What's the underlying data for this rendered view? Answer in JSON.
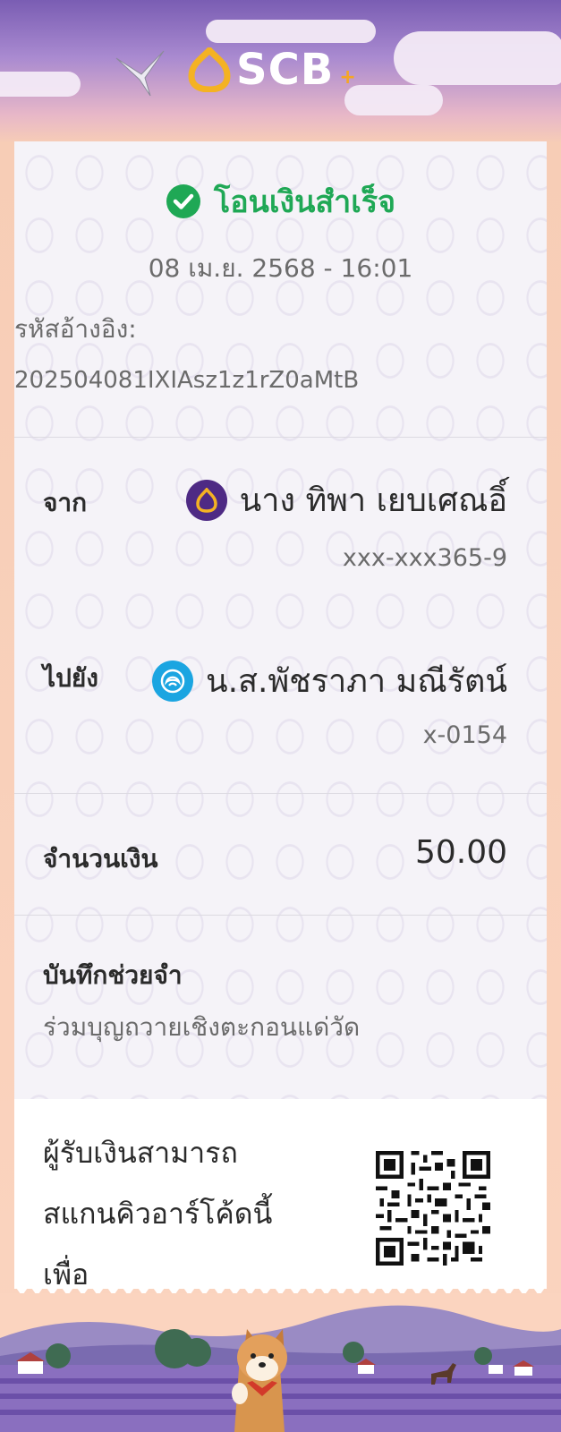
{
  "header": {
    "logo_text": "SCB",
    "logo_plus": "+"
  },
  "status": {
    "text": "โอนเงินสำเร็จ"
  },
  "datetime": "08 เม.ย. 2568 - 16:01",
  "reference": {
    "label": "รหัสอ้างอิง:",
    "value": "202504081IXIAsz1z1rZ0aMtB"
  },
  "from": {
    "label": "จาก",
    "name": "นาง ทิพา เยบเศณอิ์",
    "account": "xxx-xxx365-9",
    "bank_icon": "scb-icon",
    "bank_color": "#4e2a84"
  },
  "to": {
    "label": "ไปยัง",
    "name": "น.ส.พัชราภา มณีรัตน์",
    "account": "x-0154",
    "bank_icon": "krungthai-icon",
    "bank_color": "#1ba5e1"
  },
  "amount": {
    "label": "จำนวนเงิน",
    "value": "50.00"
  },
  "memo": {
    "label": "บันทึกช่วยจำ",
    "text": "ร่วมบุญถวายเชิงตะกอนแด่วัด"
  },
  "qr_section": {
    "line1": "ผู้รับเงินสามารถ",
    "line2": "สแกนคิวอาร์โค้ดนี้",
    "line3": "เพื่อ"
  },
  "colors": {
    "success": "#1fa855",
    "brand": "#4e2a84",
    "accent": "#f5a623"
  }
}
